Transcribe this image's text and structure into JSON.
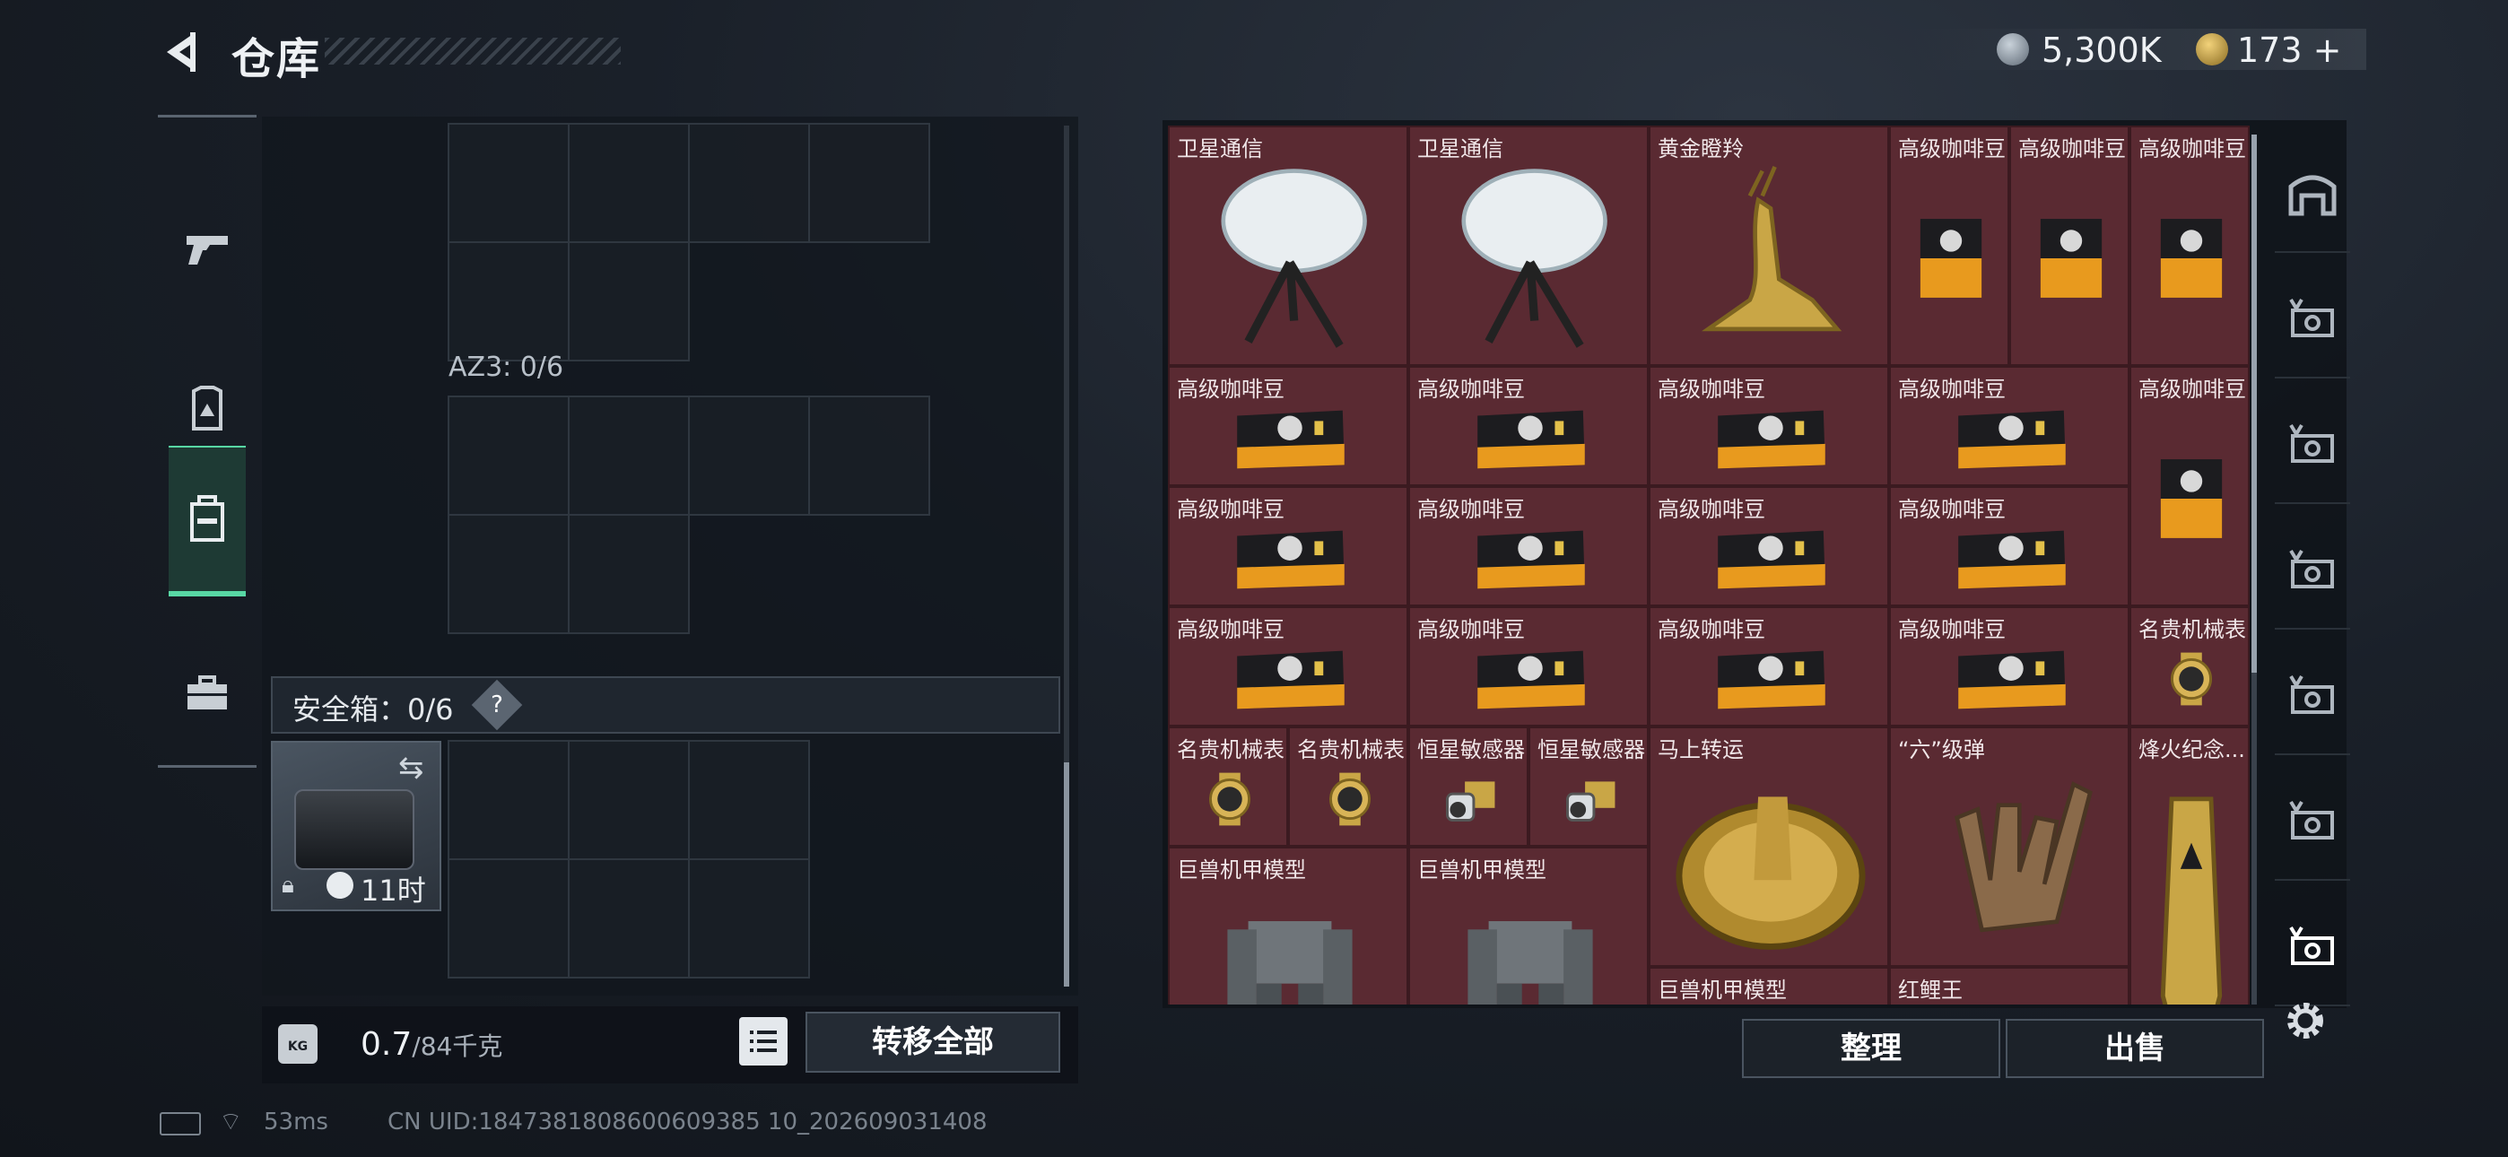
{
  "header": {
    "title": "仓库",
    "back_icon": "back-arrow-icon"
  },
  "currency": {
    "silver_value": "5,300K",
    "gold_value": "173",
    "gold_plus": "+"
  },
  "categories": [
    {
      "name": "weapons",
      "icon": "pistol-icon"
    },
    {
      "name": "gear",
      "icon": "armor-icon"
    },
    {
      "name": "backpack",
      "icon": "backpack-icon",
      "active": true
    },
    {
      "name": "toolbox",
      "icon": "toolbox-icon"
    }
  ],
  "left": {
    "az3_label": "AZ3: 0/6",
    "safebox_label": "安全箱：0/6",
    "help": "?",
    "timer": "11时",
    "weight_value": "0.7",
    "weight_max": "/84千克",
    "transfer_all": "转移全部",
    "kg_label": "KG"
  },
  "inventory": [
    {
      "name": "卫星通信"
    },
    {
      "name": "卫星通信"
    },
    {
      "name": "黄金瞪羚"
    },
    {
      "name": "高级咖啡豆"
    },
    {
      "name": "高级咖啡豆"
    },
    {
      "name": "高级咖啡豆"
    },
    {
      "name": "高级咖啡豆"
    },
    {
      "name": "高级咖啡豆"
    },
    {
      "name": "高级咖啡豆"
    },
    {
      "name": "高级咖啡豆"
    },
    {
      "name": "高级咖啡豆"
    },
    {
      "name": "高级咖啡豆"
    },
    {
      "name": "高级咖啡豆"
    },
    {
      "name": "高级咖啡豆"
    },
    {
      "name": "高级咖啡豆"
    },
    {
      "name": "高级咖啡豆"
    },
    {
      "name": "高级咖啡豆"
    },
    {
      "name": "高级咖啡豆"
    },
    {
      "name": "高级咖啡豆"
    },
    {
      "name": "名贵机械表"
    },
    {
      "name": "名贵机械表"
    },
    {
      "name": "名贵机械表"
    },
    {
      "name": "恒星敏感器"
    },
    {
      "name": "恒星敏感器"
    },
    {
      "name": "马上转运"
    },
    {
      "name": "“六”级弹"
    },
    {
      "name": "烽火纪念..."
    },
    {
      "name": "巨兽机甲模型"
    },
    {
      "name": "巨兽机甲模型"
    },
    {
      "name": "巨兽机甲模型"
    },
    {
      "name": "红鲤王"
    }
  ],
  "actions": {
    "sort": "整理",
    "sell": "出售"
  },
  "filters": [
    "vault-icon",
    "filter-all-icon",
    "filter-v-icon",
    "filter-v2-icon",
    "filter-v3-icon",
    "filter-iv-icon",
    "filter-v-selected-icon"
  ],
  "status": {
    "ping": "53ms",
    "uid": "CN UID:1847381808600609385 10_202609031408"
  },
  "colors": {
    "accent": "#58d7a4",
    "item_bg": "#5a2a32"
  }
}
